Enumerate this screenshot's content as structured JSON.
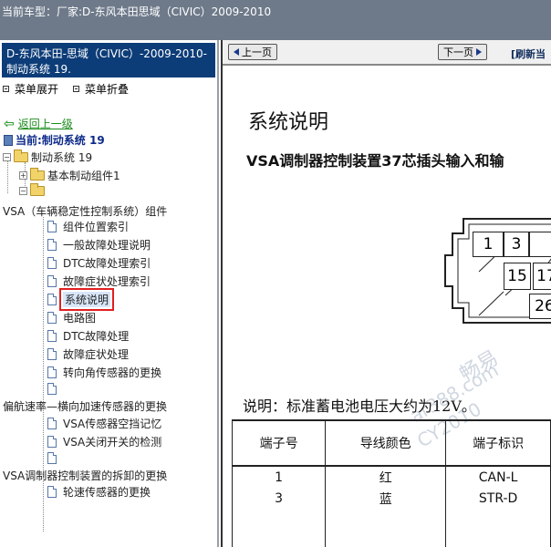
{
  "topbar": {
    "vehicle_label": "当前车型：",
    "vehicle_value": "厂家:D-东风本田思域（CIVIC）2009-2010"
  },
  "sidebar": {
    "header": "D-东风本田-思域（CIVIC）-2009-2010- 制动系统 19.",
    "expand_all": "菜单展开",
    "collapse_all": "菜单折叠",
    "back": "返回上一级",
    "current": "当前:制动系统 19",
    "tree": {
      "root": "制动系统 19",
      "basic_group": "基本制动组件1",
      "vsa_group": "VSA（车辆稳定性控制系统）组件",
      "vsa_items": [
        "组件位置索引",
        "一般故障处理说明",
        "DTC故障处理索引",
        "故障症状处理索引",
        "系统说明",
        "电路图",
        "DTC故障处理",
        "故障症状处理",
        "转向角传感器的更换"
      ],
      "yaw_group": "偏航速率—横向加速传感器的更换",
      "yaw_items": [
        "VSA传感器空挡记忆",
        "VSA关闭开关的检测"
      ],
      "modulator_group": "VSA调制器控制装置的拆卸的更换",
      "modulator_items": [
        "轮速传感器的更换"
      ]
    }
  },
  "nav": {
    "prev": "上一页",
    "next": "下一页",
    "refresh": "[刷新当"
  },
  "content": {
    "title": "系统说明",
    "subtitle": "VSA调制器控制装置37芯插头输入和输",
    "connector_pins": [
      "1",
      "3",
      "15",
      "17",
      "26"
    ],
    "note": "说明：标准蓄电池电压大约为12V。",
    "table": {
      "headers": [
        "端子号",
        "导线颜色",
        "端子标识"
      ],
      "rows": [
        [
          "1",
          "红",
          "CAN-L"
        ],
        [
          "3",
          "蓝",
          "STR-D"
        ]
      ]
    },
    "watermark": [
      "畅易",
      "ar388.com",
      "CY2010"
    ]
  }
}
